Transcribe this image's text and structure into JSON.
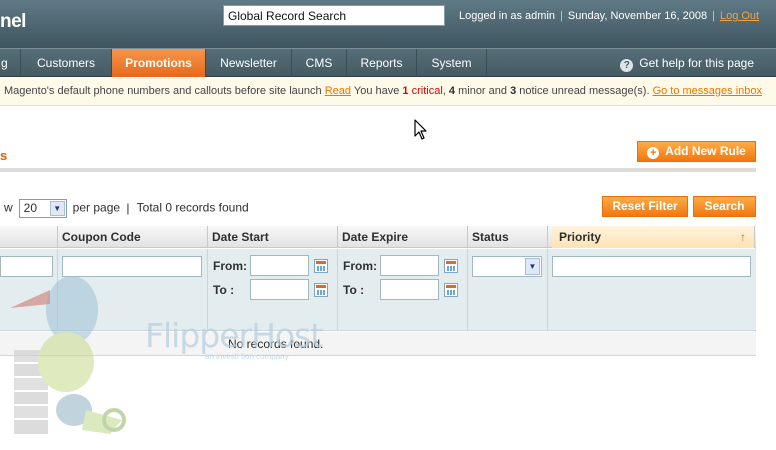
{
  "header": {
    "logo_text": "nel",
    "search_placeholder": "Global Record Search",
    "logged_in": "Logged in as admin",
    "date": "Sunday, November 16, 2008",
    "logout": "Log Out"
  },
  "nav": {
    "items": [
      {
        "label": "g"
      },
      {
        "label": "Customers"
      },
      {
        "label": "Promotions",
        "active": true
      },
      {
        "label": "Newsletter"
      },
      {
        "label": "CMS"
      },
      {
        "label": "Reports"
      },
      {
        "label": "System"
      }
    ],
    "help": "Get help for this page"
  },
  "notice": {
    "text": "Magento's default phone numbers and callouts before site launch",
    "read_link": "Read",
    "you_have": "You have",
    "critical_count": "1",
    "critical_label": "critical",
    "minor_count": "4",
    "minor_label": "minor and",
    "notice_count": "3",
    "notice_label": "notice unread message(s).",
    "messages_link": "Go to messages inbox"
  },
  "page": {
    "title": "s",
    "add_button": "Add New Rule"
  },
  "pager": {
    "view_prefix": "w",
    "per_page_value": "20",
    "per_page_label": "per page",
    "separator": "|",
    "total": "Total 0 records found"
  },
  "buttons": {
    "reset": "Reset Filter",
    "search": "Search"
  },
  "grid": {
    "columns": [
      {
        "label": ""
      },
      {
        "label": "Coupon Code"
      },
      {
        "label": "Date Start"
      },
      {
        "label": "Date Expire"
      },
      {
        "label": "Status"
      },
      {
        "label": "Priority",
        "sorted": true
      }
    ],
    "sort_arrow": "↑",
    "from_label": "From:",
    "to_label": "To :",
    "empty": "No records found."
  },
  "watermark": {
    "brand": "FlipperHost",
    "tagline": "an investi tion company"
  },
  "colors": {
    "accent": "#eb5e00",
    "header": "#4b636d",
    "button": "#f1770f"
  }
}
